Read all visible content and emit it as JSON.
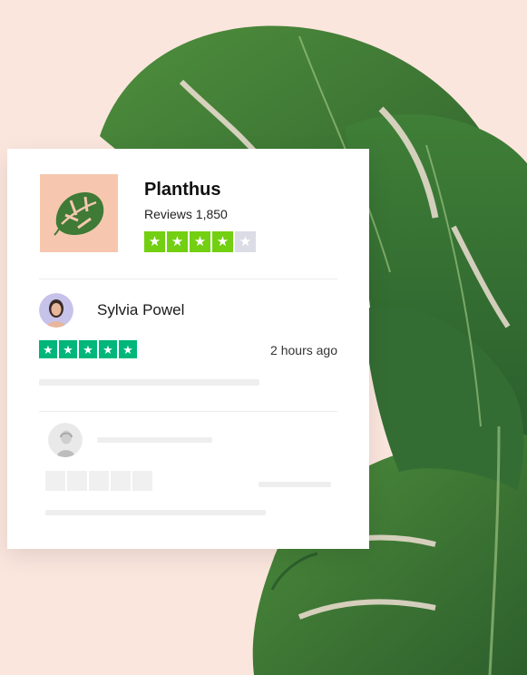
{
  "business": {
    "name": "Planthus",
    "reviews_label": "Reviews 1,850",
    "rating": 4,
    "max_rating": 5
  },
  "review": {
    "reviewer_name": "Sylvia Powel",
    "rating": 5,
    "time_ago": "2 hours ago"
  },
  "icons": {
    "star": "star-icon",
    "business_logo": "monstera-leaf-icon",
    "reviewer_avatar": "person-avatar",
    "placeholder_avatar": "person-avatar-grey"
  },
  "colors": {
    "background": "#fbe6de",
    "logo_bg": "#f6c7ae",
    "star_business": "#73cf11",
    "star_review": "#00b67a",
    "star_empty": "#dcdce6",
    "leaf": "#3a7a3a"
  }
}
